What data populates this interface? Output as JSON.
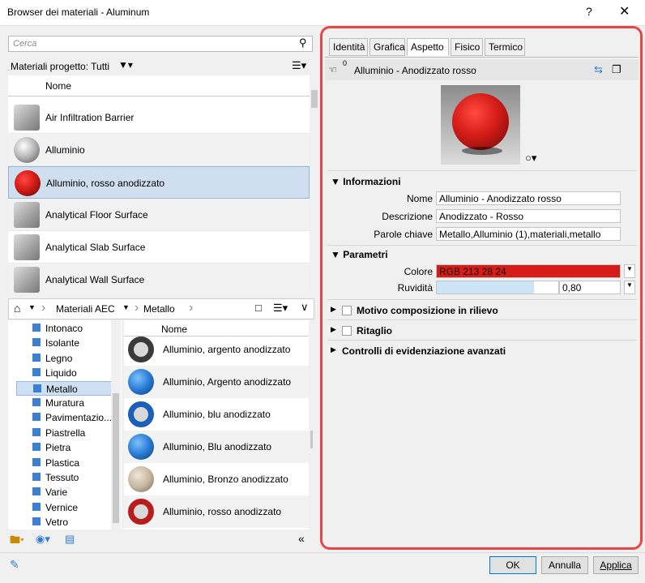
{
  "window": {
    "title": "Browser dei materiali - Aluminum",
    "help": "?",
    "close": "✕"
  },
  "search": {
    "placeholder": "Cerca"
  },
  "project": {
    "filter_label": "Materiali progetto: Tutti",
    "column_header": "Nome",
    "materials": [
      {
        "name": "Air Infiltration Barrier",
        "thumb": "grey-cylinder"
      },
      {
        "name": "Alluminio",
        "thumb": "silver-sphere"
      },
      {
        "name": "Alluminio, rosso anodizzato",
        "thumb": "red-sphere",
        "selected": true
      },
      {
        "name": "Analytical Floor Surface",
        "thumb": "grey-cylinder"
      },
      {
        "name": "Analytical Slab Surface",
        "thumb": "grey-cylinder"
      },
      {
        "name": "Analytical Wall Surface",
        "thumb": "grey-cylinder"
      }
    ]
  },
  "library": {
    "breadcrumb": [
      "Materiali AEC",
      "Metallo"
    ],
    "tree": [
      "Intonaco",
      "Isolante",
      "Legno",
      "Liquido",
      "Metallo",
      "Muratura",
      "Pavimentazio...",
      "Piastrella",
      "Pietra",
      "Plastica",
      "Tessuto",
      "Varie",
      "Vernice",
      "Vetro"
    ],
    "tree_selected": "Metallo",
    "column_header": "Nome",
    "items": [
      {
        "name": "Alluminio, argento anodizzato",
        "thumb": "dark-ring"
      },
      {
        "name": "Alluminio, Argento anodizzato",
        "thumb": "blue-sphere"
      },
      {
        "name": "Alluminio, blu anodizzato",
        "thumb": "blue-ring"
      },
      {
        "name": "Alluminio, Blu anodizzato",
        "thumb": "blue-sphere"
      },
      {
        "name": "Alluminio, Bronzo anodizzato",
        "thumb": "bronze-sphere"
      },
      {
        "name": "Alluminio, rosso anodizzato",
        "thumb": "red-ring"
      }
    ]
  },
  "editor": {
    "tabs": [
      "Identità",
      "Grafica",
      "Aspetto",
      "Fisico",
      "Termico"
    ],
    "active_tab": "Aspetto",
    "asset_count": "0",
    "asset_name": "Alluminio - Anodizzato rosso",
    "info": {
      "heading": "Informazioni",
      "name_label": "Nome",
      "name_value": "Alluminio - Anodizzato rosso",
      "desc_label": "Descrizione",
      "desc_value": "Anodizzato - Rosso",
      "keywords_label": "Parole chiave",
      "keywords_value": "Metallo,Alluminio (1),materiali,metallo"
    },
    "params": {
      "heading": "Parametri",
      "color_label": "Colore",
      "color_value": "RGB 213 28 24",
      "color_hex": "#d51c18",
      "rough_label": "Ruvidità",
      "rough_value": "0,80",
      "rough_fraction": 0.8
    },
    "collapsed": [
      "Motivo composizione in rilievo",
      "Ritaglio",
      "Controlli di evidenziazione avanzati"
    ]
  },
  "buttons": {
    "ok": "OK",
    "cancel": "Annulla",
    "apply": "Applica"
  }
}
